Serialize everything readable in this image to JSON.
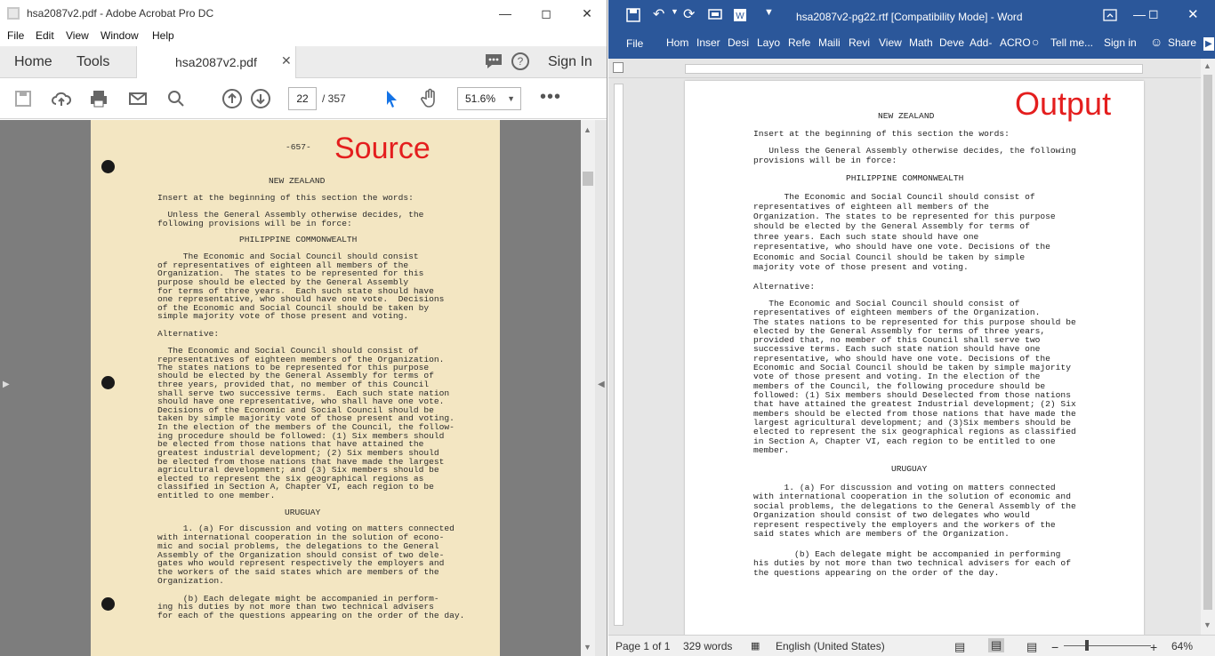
{
  "acrobat": {
    "title": "hsa2087v2.pdf - Adobe Acrobat Pro DC",
    "menu": [
      "File",
      "Edit",
      "View",
      "Window",
      "Help"
    ],
    "tabs": {
      "home": "Home",
      "tools": "Tools",
      "doc": "hsa2087v2.pdf",
      "sign_in": "Sign In"
    },
    "page_current": "22",
    "page_total": "/ 357",
    "zoom": "51.6%",
    "overlay_label": "Source",
    "page": {
      "page_num": "-657-",
      "heading1": "NEW ZEALAND",
      "lines": [
        "Insert at the beginning of this section the words:",
        "  Unless the General Assembly otherwise decides, the",
        "following provisions will be in force:",
        "PHILIPPINE COMMONWEALTH",
        "     The Economic and Social Council should consist",
        "of representatives of eighteen all members of the",
        "Organization.  The states to be represented for this",
        "purpose should be elected by the General Assembly",
        "for terms of three years.  Each such state should have",
        "one representative, who should have one vote.  Decisions",
        "of the Economic and Social Council should be taken by",
        "simple majority vote of those present and voting.",
        "Alternative:",
        "  The Economic and Social Council should consist of",
        "representatives of eighteen members of the Organization.",
        "The states nations to be represented for this purpose",
        "should be elected by the General Assembly for terms of",
        "three years, provided that, no member of this Council",
        "shall serve two successive terms.  Each such state nation",
        "should have one representative, who shall have one vote.",
        "Decisions of the Economic and Social Council should be",
        "taken by simple majority vote of those present and voting.",
        "In the election of the members of the Council, the follow-",
        "ing procedure should be followed: (1) Six members should",
        "be elected from those nations that have attained the",
        "greatest industrial development; (2) Six members should",
        "be elected from those nations that have made the largest",
        "agricultural development; and (3) Six members should be",
        "elected to represent the six geographical regions as",
        "classified in Section A, Chapter VI, each region to be",
        "entitled to one member.",
        "URUGUAY",
        "     1. (a) For discussion and voting on matters connected",
        "with international cooperation in the solution of econo-",
        "mic and social problems, the delegations to the General",
        "Assembly of the Organization should consist of two dele-",
        "gates who would represent respectively the employers and",
        "the workers of the said states which are members of the",
        "Organization.",
        "     (b) Each delegate might be accompanied in perform-",
        "ing his duties by not more than two technical advisers",
        "for each of the questions appearing on the order of the day."
      ]
    }
  },
  "word": {
    "title": "hsa2087v2-pg22.rtf [Compatibility Mode] - Word",
    "ribbon": [
      "File",
      "Hom",
      "Inser",
      "Desi",
      "Layo",
      "Refe",
      "Maili",
      "Revi",
      "View",
      "Math",
      "Deve",
      "Add-",
      "ACRO",
      "Tell me...",
      "Sign in",
      "Share"
    ],
    "overlay_label": "Output",
    "status": {
      "page": "Page 1 of 1",
      "words": "329 words",
      "lang": "English (United States)",
      "zoom": "64%"
    },
    "doc": {
      "heading1": "NEW ZEALAND",
      "lines": [
        "Insert at the beginning of this section the words:",
        "   Unless the General Assembly otherwise decides, the following",
        "provisions will be in force:",
        "PHILIPPINE COMMONWEALTH",
        "      The Economic and Social Council should consist of",
        "representatives of eighteen all members of the",
        "Organization. The states to be represented for this purpose",
        "should be elected by the General Assembly for terms of",
        "three years. Each such state should have one",
        "representative, who should have one vote. Decisions of the",
        "Economic and Social Council should be taken by simple",
        "majority vote of those present and voting.",
        "Alternative:",
        "   The Economic and Social Council should consist of",
        "representatives of eighteen members of the Organization.",
        "The states nations to be represented for this purpose should be",
        "elected by the General Assembly for terms of three years,",
        "provided that, no member of this Council shall serve two",
        "successive terms. Each such state nation should have one",
        "representative, who should have one vote. Decisions of the",
        "Economic and Social Council should be taken by simple majority",
        "vote of those present and voting. In the election of the",
        "members of the Council, the following procedure should be",
        "followed: (1) Six members should Deselected from those nations",
        "that have attained the greatest Industrial development; (2) Six",
        "members should be elected from those nations that have made the",
        "largest agricultural development; and (3)Six members should be",
        "elected to represent the six geographical regions as classified",
        "in Section A, Chapter VI, each region to be entitled to one",
        "member.",
        "URUGUAY",
        "      1. (a) For discussion and voting on matters connected",
        "with international cooperation in the solution of economic and",
        "social problems, the delegations to the General Assembly of the",
        "Organization should consist of two delegates who would",
        "represent respectively the employers and the workers of the",
        "said states which are members of the Organization.",
        "        (b) Each delegate might be accompanied in performing",
        "his duties by not more than two technical advisers for each of",
        "the questions appearing on the order of the day."
      ]
    }
  }
}
